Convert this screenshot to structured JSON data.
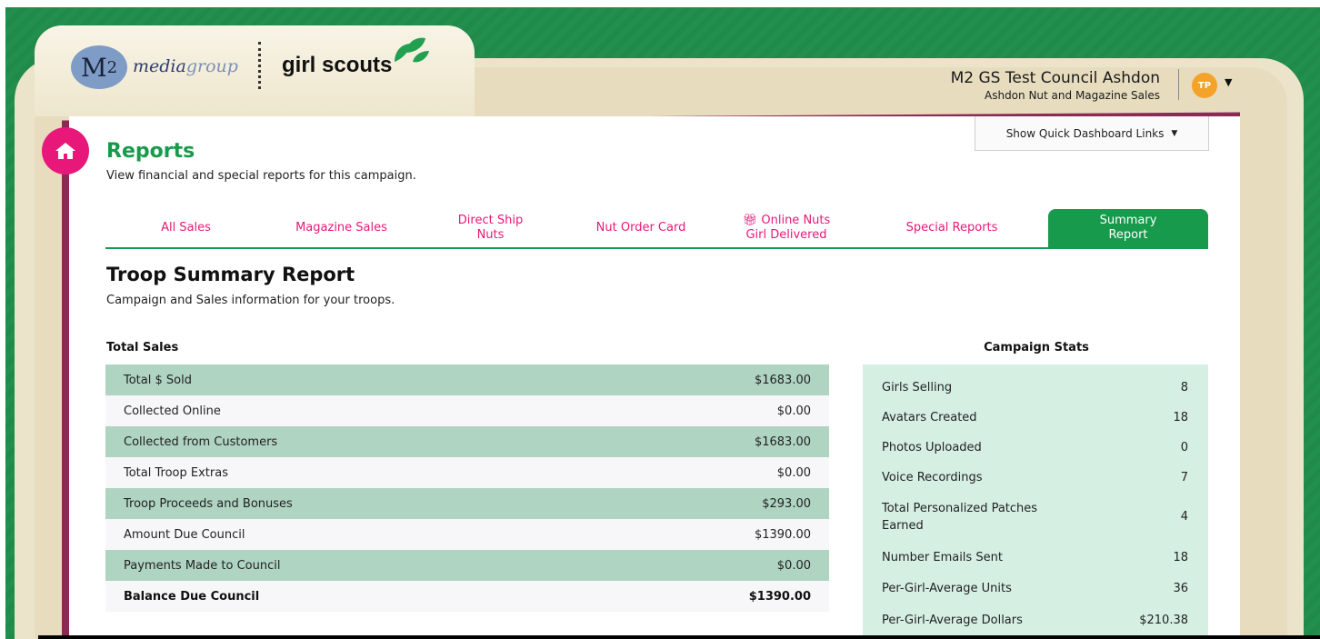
{
  "brand": {
    "m2_letter": "M",
    "m2_sub": "2",
    "media": "media",
    "group": "group",
    "girl_scouts": "girl scouts"
  },
  "account": {
    "org": "M2 GS Test Council Ashdon",
    "campaign": "Ashdon Nut and Magazine Sales",
    "avatar_initials": "TP"
  },
  "quick_links_label": "Show Quick Dashboard Links",
  "page": {
    "title": "Reports",
    "subtitle": "View financial and special reports for this campaign."
  },
  "tabs": [
    {
      "line1": "All Sales",
      "line2": ""
    },
    {
      "line1": "Magazine Sales",
      "line2": ""
    },
    {
      "line1": "Direct Ship",
      "line2": "Nuts"
    },
    {
      "line1": "Nut Order Card",
      "line2": ""
    },
    {
      "line1": "Online Nuts",
      "line2": "Girl Delivered",
      "icon": "gift-icon"
    },
    {
      "line1": "Special Reports",
      "line2": ""
    },
    {
      "line1": "Summary",
      "line2": "Report",
      "active": true
    }
  ],
  "report": {
    "title": "Troop Summary Report",
    "subtitle": "Campaign and Sales information for your troops."
  },
  "total_sales": {
    "heading": "Total Sales",
    "rows": [
      {
        "label": "Total $ Sold",
        "value": "$1683.00"
      },
      {
        "label": "Collected Online",
        "value": "$0.00"
      },
      {
        "label": "Collected from Customers",
        "value": "$1683.00"
      },
      {
        "label": "Total Troop Extras",
        "value": "$0.00"
      },
      {
        "label": "Troop Proceeds and Bonuses",
        "value": "$293.00"
      },
      {
        "label": "Amount Due Council",
        "value": "$1390.00"
      },
      {
        "label": "Payments Made to Council",
        "value": "$0.00"
      },
      {
        "label": "Balance Due Council",
        "value": "$1390.00"
      }
    ]
  },
  "campaign_stats": {
    "heading": "Campaign Stats",
    "rows": [
      {
        "label": "Girls Selling",
        "value": "8"
      },
      {
        "label": "Avatars Created",
        "value": "18"
      },
      {
        "label": "Photos Uploaded",
        "value": "0"
      },
      {
        "label": "Voice Recordings",
        "value": "7"
      },
      {
        "label": "Total Personalized Patches",
        "label2": "Earned",
        "value": "4"
      },
      {
        "label": "Number Emails Sent",
        "value": "18"
      },
      {
        "label": "Per-Girl-Average Units",
        "value": "36"
      },
      {
        "label": "Per-Girl-Average Dollars",
        "value": "$210.38"
      }
    ]
  },
  "colors": {
    "brand_green": "#179a4b",
    "accent_pink": "#e8187a",
    "row_green": "#afd4c2",
    "stats_bg": "#d6efe3"
  }
}
